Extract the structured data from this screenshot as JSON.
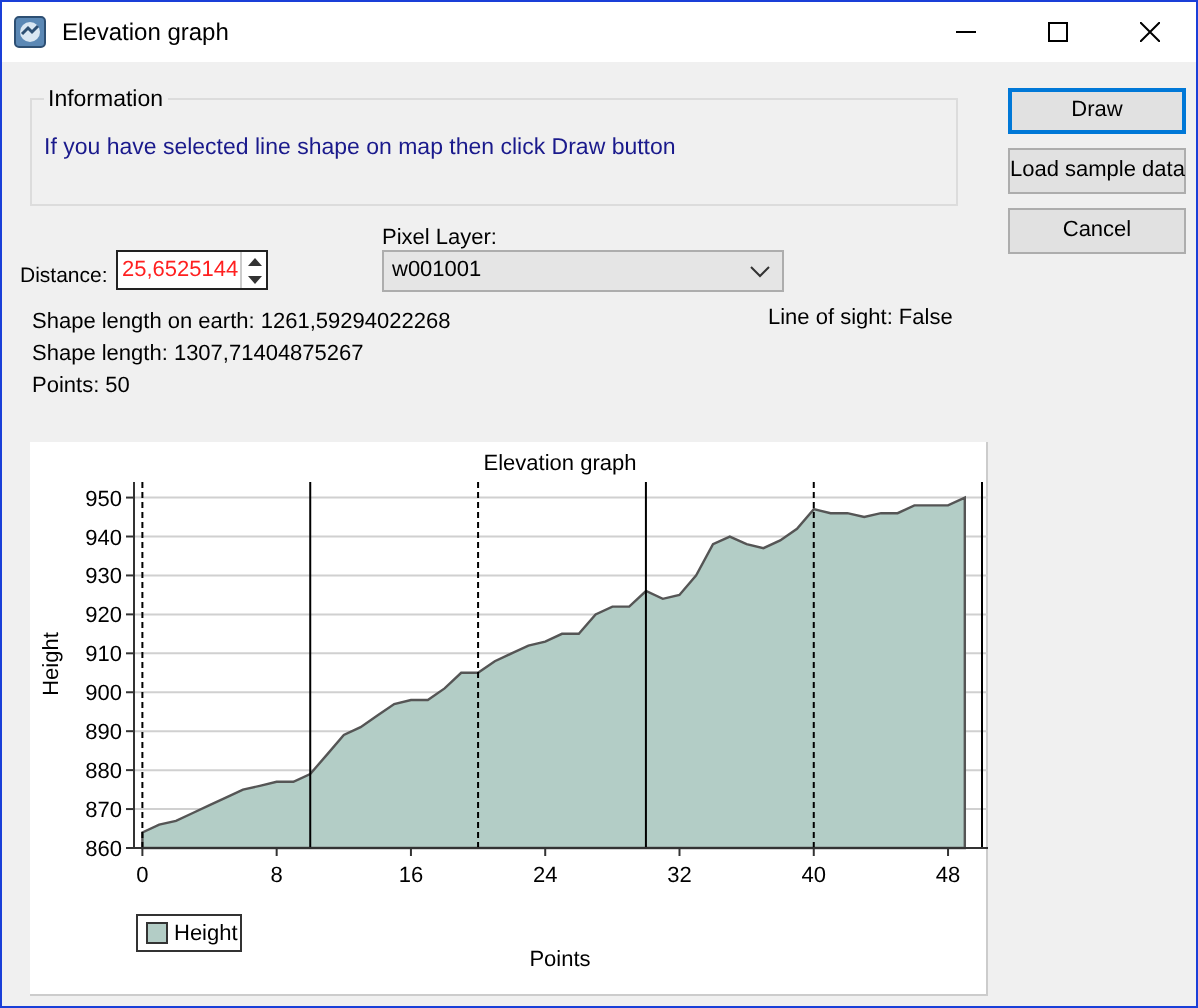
{
  "window": {
    "title": "Elevation graph"
  },
  "information": {
    "title": "Information",
    "text": "If you have selected line shape on map then click Draw button"
  },
  "buttons": [
    {
      "label": "Draw",
      "default": true
    },
    {
      "label": "Load sample data",
      "default": false
    },
    {
      "label": "Cancel",
      "default": false
    }
  ],
  "distance": {
    "label": "Distance:",
    "value": "25,6525144",
    "invalid": true
  },
  "pixel_layer": {
    "label": "Pixel Layer:",
    "value": "w001001"
  },
  "line_of_sight": "Line of sight: False",
  "stats": [
    "Shape length on earth: 1261,59294022268",
    "Shape length: 1307,71404875267",
    "Points: 50"
  ],
  "chart": {
    "chart_data": {
      "type": "area",
      "title": "Elevation graph",
      "xlabel": "Points",
      "ylabel": "Height",
      "x": [
        0,
        1,
        2,
        3,
        4,
        5,
        6,
        7,
        8,
        9,
        10,
        11,
        12,
        13,
        14,
        15,
        16,
        17,
        18,
        19,
        20,
        21,
        22,
        23,
        24,
        25,
        26,
        27,
        28,
        29,
        30,
        31,
        32,
        33,
        34,
        35,
        36,
        37,
        38,
        39,
        40,
        41,
        42,
        43,
        44,
        45,
        46,
        47,
        48,
        49
      ],
      "series": [
        {
          "name": "Height",
          "color": "#b3cdc6",
          "values": [
            864,
            866,
            867,
            869,
            871,
            873,
            875,
            876,
            877,
            877,
            879,
            884,
            889,
            891,
            894,
            897,
            898,
            898,
            901,
            905,
            905,
            908,
            910,
            912,
            913,
            915,
            915,
            920,
            922,
            922,
            926,
            924,
            925,
            930,
            938,
            940,
            938,
            937,
            939,
            942,
            947,
            946,
            946,
            945,
            946,
            946,
            948,
            948,
            948,
            950
          ]
        }
      ],
      "xlim": [
        -0.5,
        50.5
      ],
      "ylim": [
        860,
        954
      ],
      "xticks": [
        0,
        8,
        16,
        24,
        32,
        40,
        48
      ],
      "yticks": [
        860,
        870,
        880,
        890,
        900,
        910,
        920,
        930,
        940,
        950
      ],
      "grid": true
    }
  }
}
